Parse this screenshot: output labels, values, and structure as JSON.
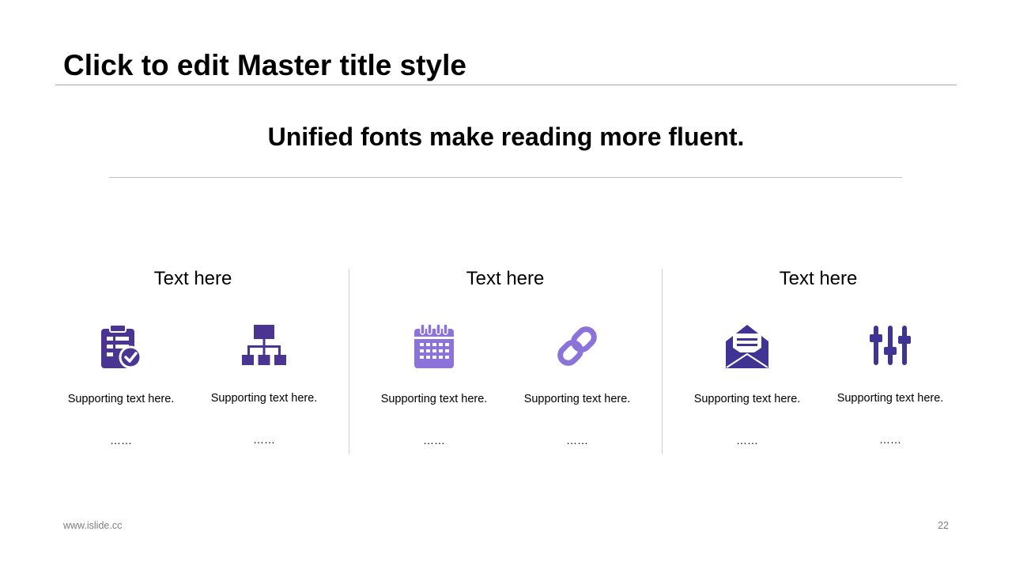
{
  "slide": {
    "title": "Click to edit Master title style",
    "subtitle": "Unified fonts make reading more fluent.",
    "footer_url": "www.islide.cc",
    "page_number": "22"
  },
  "colors": {
    "dark_purple": "#4a3692",
    "light_purple": "#8c73d9",
    "indigo": "#3f3494"
  },
  "groups": [
    {
      "heading": "Text here",
      "items": [
        {
          "icon": "clipboard-check-icon",
          "text": "Supporting text here.",
          "dots": "……"
        },
        {
          "icon": "org-chart-icon",
          "text": "Supporting text here.",
          "dots": "……"
        }
      ]
    },
    {
      "heading": "Text here",
      "items": [
        {
          "icon": "calendar-icon",
          "text": "Supporting text here.",
          "dots": "……"
        },
        {
          "icon": "link-icon",
          "text": "Supporting text here.",
          "dots": "……"
        }
      ]
    },
    {
      "heading": "Text here",
      "items": [
        {
          "icon": "open-envelope-icon",
          "text": "Supporting text here.",
          "dots": "……"
        },
        {
          "icon": "sliders-icon",
          "text": "Supporting text here.",
          "dots": "……"
        }
      ]
    }
  ]
}
